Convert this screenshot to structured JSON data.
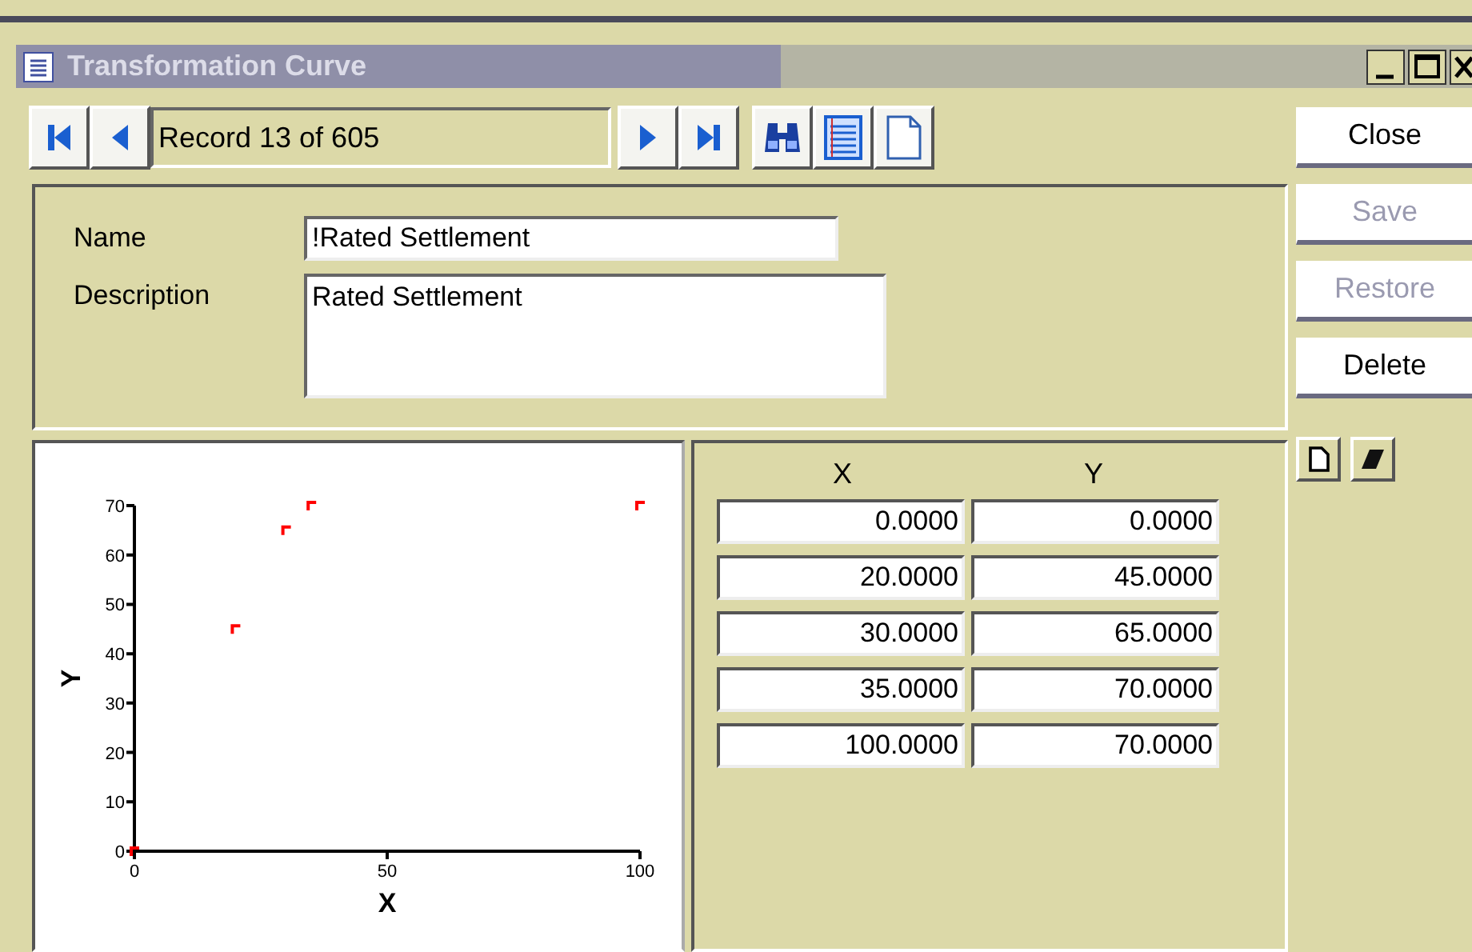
{
  "window": {
    "title": "Transformation Curve"
  },
  "navigator": {
    "record": "Record 13 of 605"
  },
  "form": {
    "name_label": "Name",
    "name": "!Rated Settlement",
    "description_label": "Description",
    "description": "Rated Settlement"
  },
  "chart": {
    "chart_data": {
      "type": "scatter",
      "xlabel": "X",
      "ylabel": "Y",
      "x": [
        0,
        20,
        30,
        35,
        100
      ],
      "series": [
        {
          "color": "#ff0000",
          "values": [
            0,
            45,
            65,
            70,
            70
          ]
        }
      ],
      "xlim": [
        0,
        100
      ],
      "ylim": [
        0,
        70
      ],
      "xticks": [
        0,
        50,
        100
      ],
      "yticks": [
        0,
        10,
        20,
        30,
        40,
        50,
        60,
        70
      ]
    }
  },
  "grid": {
    "columns": [
      "X",
      "Y"
    ],
    "rows": [
      [
        "0.0000",
        "0.0000"
      ],
      [
        "20.0000",
        "45.0000"
      ],
      [
        "30.0000",
        "65.0000"
      ],
      [
        "35.0000",
        "70.0000"
      ],
      [
        "100.0000",
        "70.0000"
      ]
    ]
  },
  "buttons": [
    {
      "label": "Close",
      "disabled": false
    },
    {
      "label": "Save",
      "disabled": true
    },
    {
      "label": "Restore",
      "disabled": true
    },
    {
      "label": "Delete",
      "disabled": false
    }
  ]
}
